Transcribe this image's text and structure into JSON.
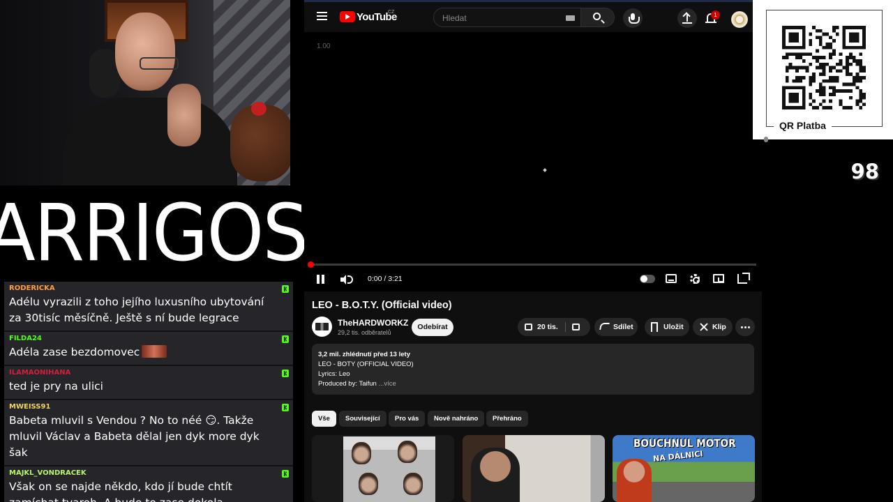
{
  "logo": {
    "text": "ARRIGOS"
  },
  "chat": {
    "messages": [
      {
        "user": "RODERICKA",
        "color": "#ff9e3d",
        "text": "Adélu vyrazili z toho jejího luxusního ubytování za 30tisíc měsíčně. Ještě s ní bude legrace"
      },
      {
        "user": "FILDA24",
        "color": "#53fc18",
        "text": "Adéla zase bezdomovec"
      },
      {
        "user": "ILAMAONIHANA",
        "color": "#d11f3f",
        "text": "ted je pry na ulici"
      },
      {
        "user": "MWEISS91",
        "color": "#f4d35e",
        "text": "Babeta mluvil s Vendou ? No to néé 😏. Takže mluvil Václav a Babeta dělal jen dyk more dyk šak"
      },
      {
        "user": "MAJKL_VONDRACEK",
        "color": "#b9f26b",
        "text": "Však on se najde někdo, kdo jí bude chtít zamíchat tvaroh. A bude to zase dokola."
      }
    ]
  },
  "youtube": {
    "logo_text": "YouTube",
    "logo_region": "CZ",
    "search_placeholder": "Hledat",
    "notifications_count": "1",
    "player": {
      "speed_label": "1.00",
      "time": "0:00 / 3:21"
    },
    "video": {
      "title": "LEO - B.O.T.Y. (Official video)",
      "channel": "TheHARDWORKZ",
      "subscribers": "29,2 tis. odběratelů",
      "subscribe_label": "Odebírat",
      "likes": "20 tis.",
      "share_label": "Sdílet",
      "save_label": "Uložit",
      "clip_label": "Klip"
    },
    "description": {
      "meta": "3,2 mil. zhlédnutí  před 13 lety",
      "line1": "LEO - BOTY (OFFICIAL VIDEO)",
      "line2": "Lyrics: Leo",
      "line3": "Produced by: Taifun",
      "more": "...více"
    },
    "chips": [
      "Vše",
      "Související",
      "Pro vás",
      "Nově nahráno",
      "Přehráno"
    ],
    "thumbnails": [
      {
        "text": ""
      },
      {
        "text": ""
      },
      {
        "title": "BOUCHNUL MOTOR",
        "subtitle": "NA DÁLNICI"
      }
    ]
  },
  "qr": {
    "label": "QR Platba"
  },
  "counter": {
    "value": "98"
  },
  "colors": {
    "accent_red": "#ff0000",
    "kick_green": "#53fc18",
    "yt_bg": "#0f0f0f"
  }
}
